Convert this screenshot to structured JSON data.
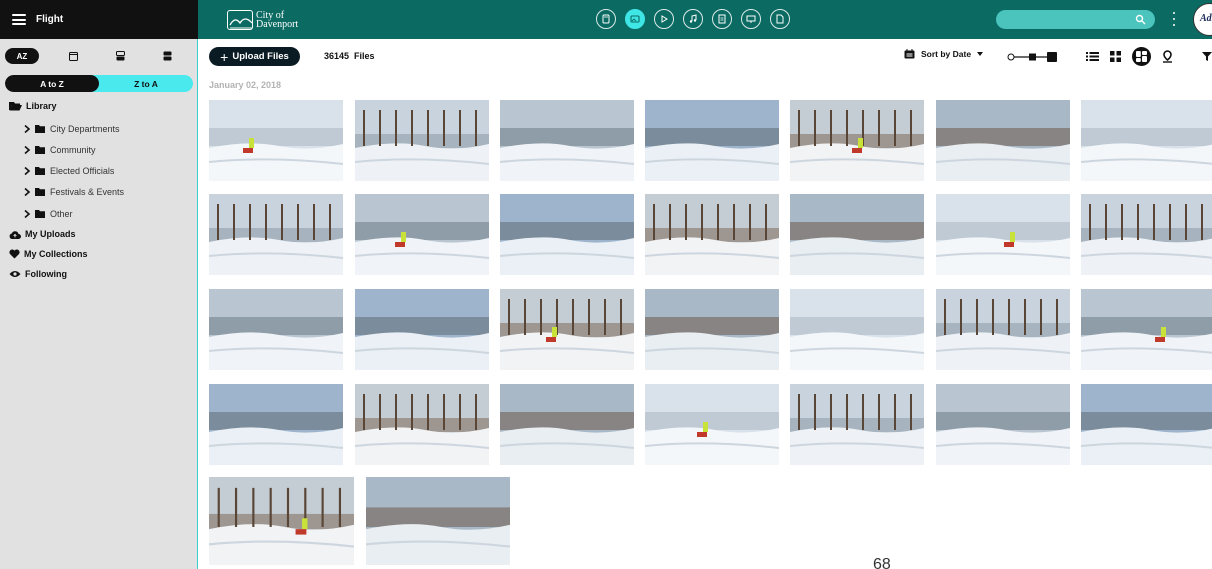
{
  "brand": {
    "name": "Flight"
  },
  "logo": {
    "line1": "City of",
    "line2": "Davenport"
  },
  "header": {
    "media_types": [
      {
        "name": "all-media",
        "active": false
      },
      {
        "name": "images",
        "active": true
      },
      {
        "name": "video",
        "active": false
      },
      {
        "name": "audio",
        "active": false
      },
      {
        "name": "documents",
        "active": false
      },
      {
        "name": "presentations",
        "active": false
      },
      {
        "name": "other-files",
        "active": false
      }
    ],
    "search": {
      "placeholder": ""
    },
    "user_badge": "Adm"
  },
  "sidebar": {
    "sort_az_label": "AZ",
    "sort_order": {
      "asc": "A to Z",
      "desc": "Z to A",
      "selected": "A to Z"
    },
    "library_label": "Library",
    "folders": [
      "City Departments",
      "Community",
      "Elected Officials",
      "Festivals & Events",
      "Other"
    ],
    "my_uploads": "My Uploads",
    "my_collections": "My Collections",
    "following": "Following"
  },
  "toolbar": {
    "upload_label": "Upload Files",
    "file_count": "36145",
    "file_count_unit": "Files",
    "sort_label": "Sort by Date",
    "view_modes": [
      "list",
      "grid",
      "mosaic",
      "map"
    ],
    "active_view": "mosaic"
  },
  "gallery": {
    "date_heading": "January 02, 2018",
    "image_count": 30
  },
  "stray_text": "68",
  "colors": {
    "header": "#0b6b63",
    "accent": "#4ae9ee",
    "sidebar": "#e0e1e0",
    "dark": "#111111"
  }
}
